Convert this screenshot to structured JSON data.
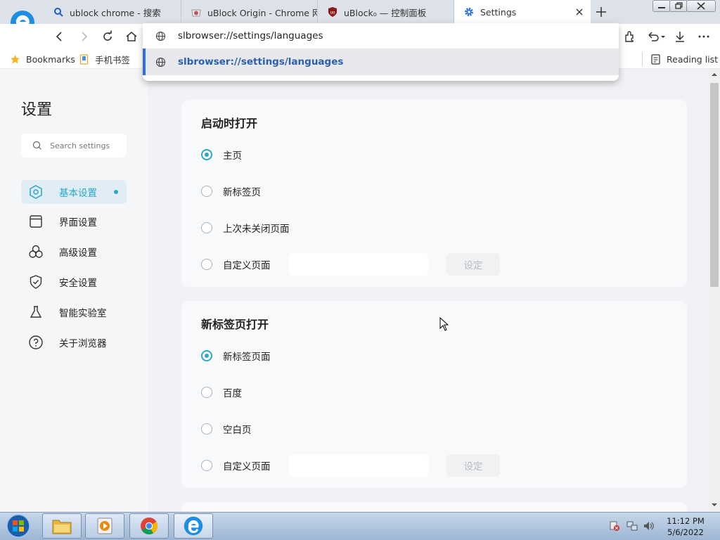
{
  "tabs": [
    {
      "title": "ublock chrome - 搜索",
      "icon": "search-icon"
    },
    {
      "title": "uBlock Origin - Chrome 网上",
      "icon": "chrome-webstore-icon"
    },
    {
      "title": "uBlock₀ — 控制面板",
      "icon": "ublock-icon"
    },
    {
      "title": "Settings",
      "icon": "gear-icon",
      "active": true
    }
  ],
  "address": {
    "value": "slbrowser://settings/languages",
    "suggestion": "slbrowser://settings/languages"
  },
  "bookmarks": {
    "bookmarks_label": "Bookmarks",
    "mobile_label": "手机书签",
    "reading_list_label": "Reading list"
  },
  "settings": {
    "title": "设置",
    "search_placeholder": "Search settings",
    "nav": [
      {
        "label": "基本设置",
        "icon": "hexagon-gear-icon",
        "active": true
      },
      {
        "label": "界面设置",
        "icon": "window-icon"
      },
      {
        "label": "高级设置",
        "icon": "advanced-icon"
      },
      {
        "label": "安全设置",
        "icon": "shield-icon"
      },
      {
        "label": "智能实验室",
        "icon": "flask-icon"
      },
      {
        "label": "关于浏览器",
        "icon": "help-icon"
      }
    ],
    "startup": {
      "title": "启动时打开",
      "options": [
        "主页",
        "新标签页",
        "上次未关闭页面",
        "自定义页面"
      ],
      "selected": 0,
      "set_button": "设定"
    },
    "newtab": {
      "title": "新标签页打开",
      "options": [
        "新标签页面",
        "百度",
        "空白页",
        "自定义页面"
      ],
      "selected": 0,
      "set_button": "设定"
    }
  },
  "taskbar": {
    "time": "11:12 PM",
    "date": "5/6/2022"
  },
  "colors": {
    "accent": "#2aa7c9",
    "link": "#2b5fb0"
  }
}
